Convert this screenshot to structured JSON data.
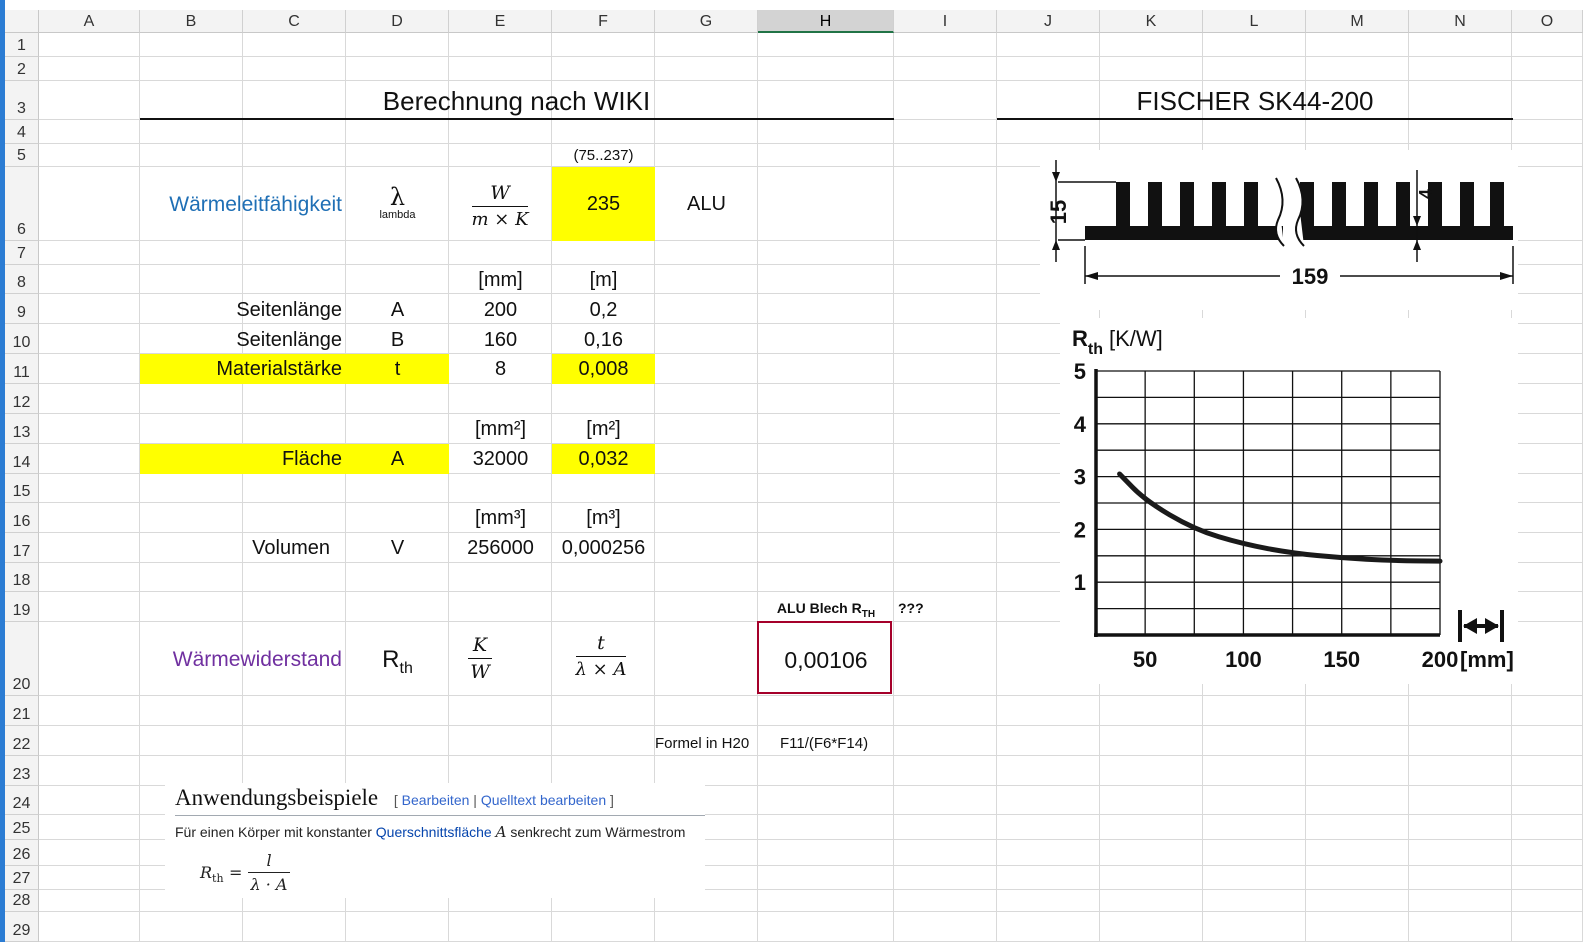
{
  "columns": [
    "A",
    "B",
    "C",
    "D",
    "E",
    "F",
    "G",
    "H",
    "I",
    "J",
    "K",
    "L",
    "M",
    "N",
    "O"
  ],
  "selected_column": "H",
  "rows": [
    "1",
    "2",
    "3",
    "4",
    "5",
    "6",
    "7",
    "8",
    "9",
    "10",
    "11",
    "12",
    "13",
    "14",
    "15",
    "16",
    "17",
    "18",
    "19",
    "20",
    "21",
    "22",
    "23",
    "24",
    "25",
    "26",
    "27",
    "28",
    "29"
  ],
  "titles": {
    "left": "Berechnung nach WIKI",
    "right": "FISCHER SK44-200"
  },
  "range_note": "(75..237)",
  "row6": {
    "label": "Wärmeleitfähigkeit",
    "symbol": "λ",
    "symbol_sub": "lambda",
    "unit_num": "W",
    "unit_den": "m × K",
    "value": "235",
    "material": "ALU"
  },
  "units_row8": {
    "e": "[mm]",
    "f": "[m]"
  },
  "row9": {
    "label": "Seitenlänge",
    "symbol": "A",
    "mm": "200",
    "m": "0,2"
  },
  "row10": {
    "label": "Seitenlänge",
    "symbol": "B",
    "mm": "160",
    "m": "0,16"
  },
  "row11": {
    "label": "Materialstärke",
    "symbol": "t",
    "mm": "8",
    "m": "0,008"
  },
  "units_row13": {
    "e": "[mm²]",
    "f": "[m²]"
  },
  "row14": {
    "label": "Fläche",
    "symbol": "A",
    "mm": "32000",
    "m": "0,032"
  },
  "units_row16": {
    "e": "[mm³]",
    "f": "[m³]"
  },
  "row17": {
    "label": "Volumen",
    "symbol": "V",
    "mm": "256000",
    "m": "0,000256"
  },
  "row19": {
    "h_label": "ALU Blech R",
    "h_label_sub": "TH",
    "i_label": "???"
  },
  "row20": {
    "label": "Wärmewiderstand",
    "symbol": "R",
    "symbol_sub": "th",
    "unit_num": "K",
    "unit_den": "W",
    "formula_num": "t",
    "formula_den": "λ × A",
    "result": "0,00106"
  },
  "row22": {
    "label": "Formel in H20",
    "formula": "F11/(F6*F14)"
  },
  "wiki": {
    "heading": "Anwendungsbeispiele",
    "edit_open": "[",
    "edit_link1": "Bearbeiten",
    "edit_sep": "|",
    "edit_link2": "Quelltext bearbeiten",
    "edit_close": "]",
    "text_before": "Für einen Körper mit konstanter",
    "text_link": "Querschnittsfläche",
    "text_var": "A",
    "text_after": "senkrecht zum Wärmestrom",
    "formula_lhs": "R",
    "formula_lhs_sub": "th",
    "formula_eq": "=",
    "formula_num": "l",
    "formula_den": "λ · A"
  },
  "profile": {
    "height_label": "15",
    "fin_label": "4",
    "width_label": "159"
  },
  "chart_data": {
    "type": "line",
    "ylabel": "R",
    "ylabel_sub": "th",
    "ylabel_unit": "[K/W]",
    "xunit": "[mm]",
    "xlim": [
      25,
      200
    ],
    "ylim": [
      0,
      5
    ],
    "xticks": [
      50,
      100,
      150,
      200
    ],
    "yticks": [
      1,
      2,
      3,
      4,
      5
    ],
    "grid": true,
    "series": [
      {
        "x": [
          37,
          50,
          75,
          100,
          125,
          150,
          175,
          200
        ],
        "y": [
          3.05,
          2.55,
          2.0,
          1.72,
          1.55,
          1.46,
          1.41,
          1.4
        ]
      }
    ]
  }
}
